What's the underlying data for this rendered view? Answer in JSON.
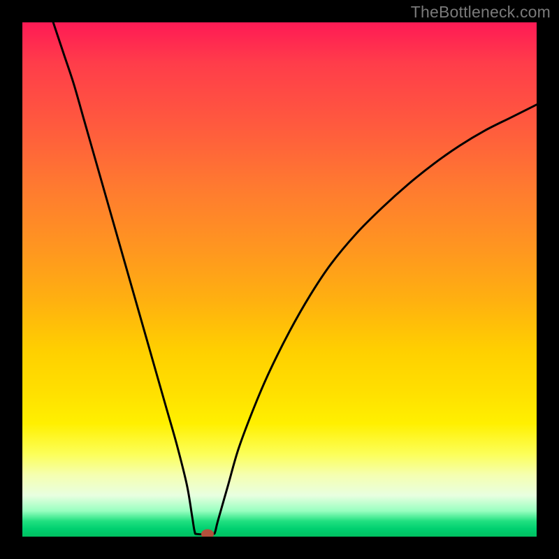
{
  "watermark": {
    "text": "TheBottleneck.com"
  },
  "chart_data": {
    "type": "line",
    "title": "",
    "xlabel": "",
    "ylabel": "",
    "xlim": [
      0,
      100
    ],
    "ylim": [
      0,
      100
    ],
    "grid": false,
    "curve_style": {
      "stroke": "#000000",
      "width": 3
    },
    "marker": {
      "x": 36.0,
      "y": 0.5,
      "color": "#b4503c",
      "rx": 9,
      "ry": 7
    },
    "series": [
      {
        "name": "bottleneck-curve",
        "points": [
          {
            "x": 6.0,
            "y": 100.0
          },
          {
            "x": 8.0,
            "y": 94.0
          },
          {
            "x": 10.0,
            "y": 88.0
          },
          {
            "x": 12.0,
            "y": 81.0
          },
          {
            "x": 14.0,
            "y": 74.0
          },
          {
            "x": 16.0,
            "y": 67.0
          },
          {
            "x": 18.0,
            "y": 60.0
          },
          {
            "x": 20.0,
            "y": 53.0
          },
          {
            "x": 22.0,
            "y": 46.0
          },
          {
            "x": 24.0,
            "y": 39.0
          },
          {
            "x": 26.0,
            "y": 32.0
          },
          {
            "x": 28.0,
            "y": 25.0
          },
          {
            "x": 30.0,
            "y": 18.0
          },
          {
            "x": 32.0,
            "y": 10.0
          },
          {
            "x": 33.0,
            "y": 4.0
          },
          {
            "x": 33.5,
            "y": 1.0
          },
          {
            "x": 34.0,
            "y": 0.5
          },
          {
            "x": 37.0,
            "y": 0.5
          },
          {
            "x": 37.5,
            "y": 1.0
          },
          {
            "x": 38.0,
            "y": 3.0
          },
          {
            "x": 40.0,
            "y": 10.0
          },
          {
            "x": 42.0,
            "y": 17.0
          },
          {
            "x": 45.0,
            "y": 25.0
          },
          {
            "x": 48.0,
            "y": 32.0
          },
          {
            "x": 52.0,
            "y": 40.0
          },
          {
            "x": 56.0,
            "y": 47.0
          },
          {
            "x": 60.0,
            "y": 53.0
          },
          {
            "x": 65.0,
            "y": 59.0
          },
          {
            "x": 70.0,
            "y": 64.0
          },
          {
            "x": 75.0,
            "y": 68.5
          },
          {
            "x": 80.0,
            "y": 72.5
          },
          {
            "x": 85.0,
            "y": 76.0
          },
          {
            "x": 90.0,
            "y": 79.0
          },
          {
            "x": 95.0,
            "y": 81.5
          },
          {
            "x": 100.0,
            "y": 84.0
          }
        ]
      }
    ]
  }
}
